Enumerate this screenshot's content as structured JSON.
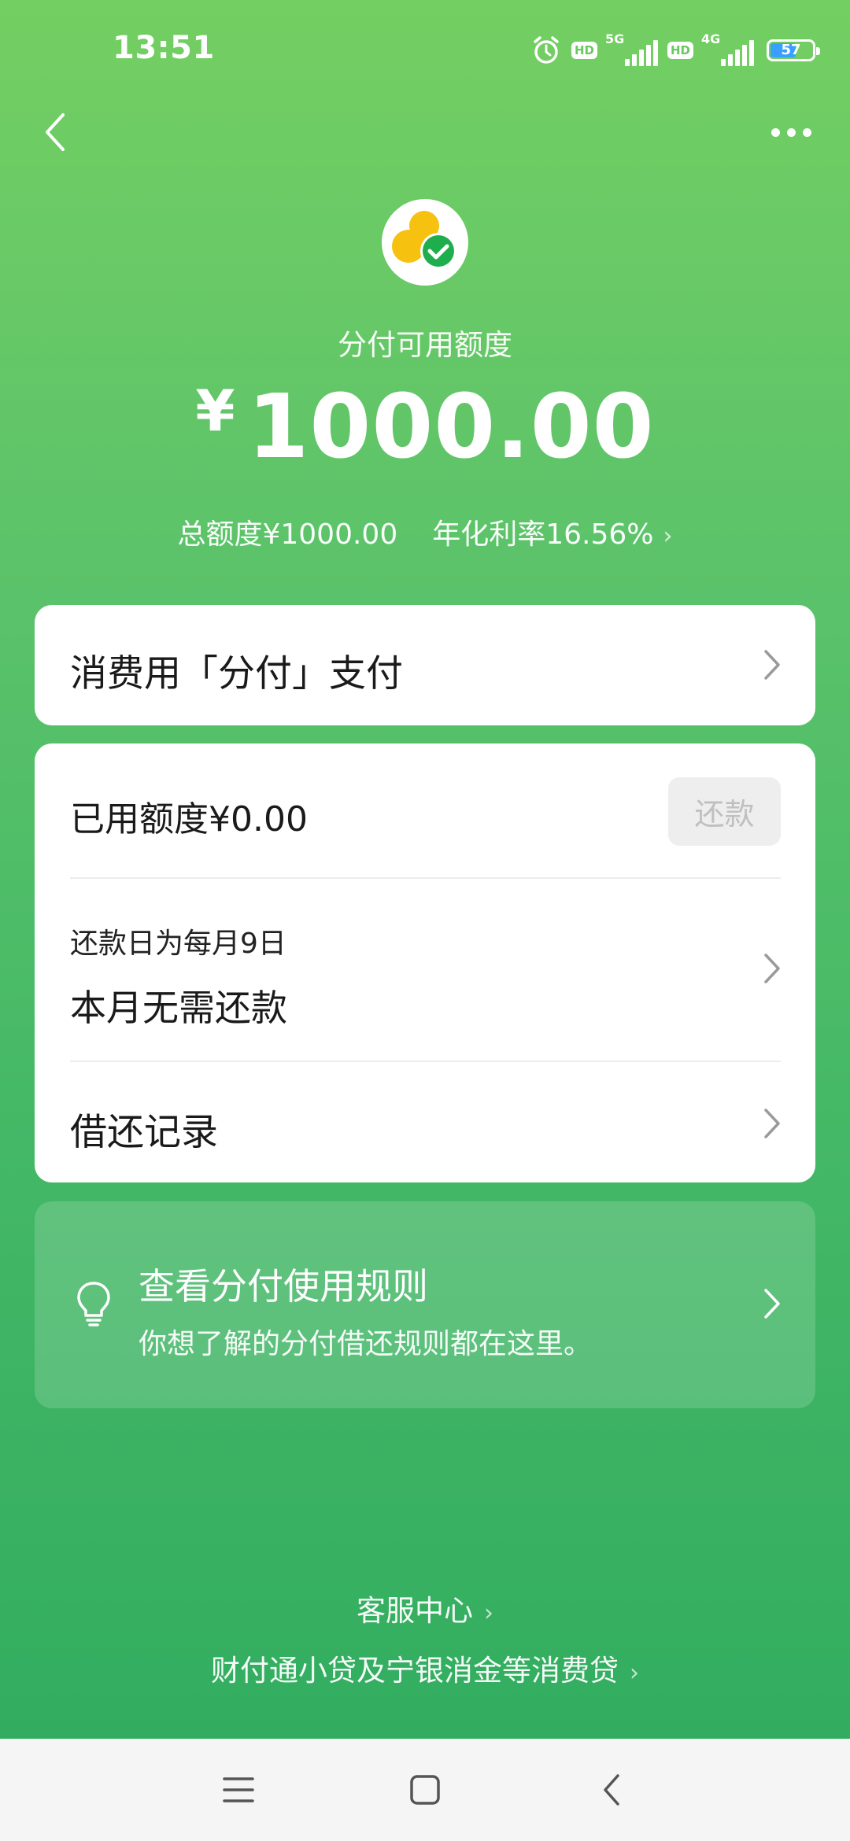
{
  "status_bar": {
    "time": "13:51",
    "hd_label_1": "HD",
    "network_1": "5G",
    "hd_label_2": "HD",
    "network_2": "4G",
    "battery_level": "57"
  },
  "header": {
    "available_label": "分付可用额度",
    "currency_symbol": "¥",
    "available_amount": "1000.00",
    "total_limit": "总额度¥1000.00",
    "annual_rate": "年化利率16.56%"
  },
  "pay_card": {
    "label": "消费用「分付」支付"
  },
  "usage_card": {
    "used_label": "已用额度¥0.00",
    "repay_button": "还款",
    "due_day": "还款日为每月9日",
    "status": "本月无需还款",
    "records": "借还记录"
  },
  "rules_card": {
    "title": "查看分付使用规则",
    "description": "你想了解的分付借还规则都在这里。"
  },
  "footer": {
    "service_center": "客服中心",
    "loan_info": "财付通小贷及宁银消金等消费贷"
  },
  "colors": {
    "gradient_top": "#74cf62",
    "gradient_bottom": "#2fab5e",
    "logo_yellow": "#f6c10f",
    "logo_green": "#1fae4d",
    "battery_fill": "#3aa0ff"
  }
}
